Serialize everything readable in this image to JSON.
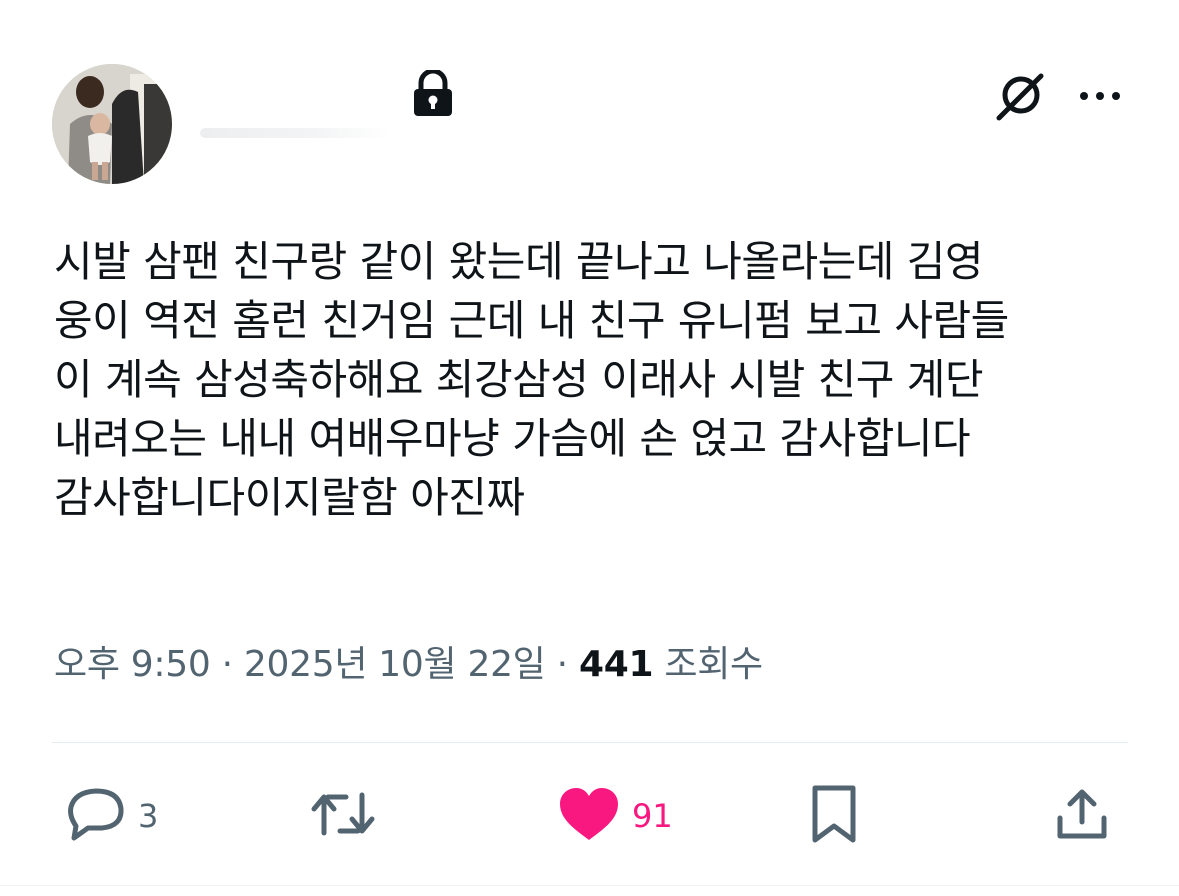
{
  "tweet": {
    "text_lines": [
      "시발 삼팬 친구랑 같이 왔는데 끝나고 나올라는데 김영",
      "웅이 역전 홈런 친거임 근데 내 친구 유니펌 보고 사람들",
      "이 계속 삼성축하해요 최강삼성 이래사 시발 친구 계단",
      "내려오는 내내 여배우마냥 가슴에 손 얹고 감사합니다",
      "감사합니다이지랄함 아진짜"
    ],
    "time": "오후 9:50",
    "separator": "·",
    "date": "2025년 10월 22일",
    "views_count": "441",
    "views_label": "조회수"
  },
  "actions": {
    "reply_count": "3",
    "like_count": "91"
  },
  "icons": {
    "lock": "lock-icon",
    "grok": "grok-icon",
    "more": "more-icon",
    "reply": "reply-icon",
    "retweet": "retweet-icon",
    "like": "heart-icon",
    "bookmark": "bookmark-icon",
    "share": "share-icon"
  },
  "colors": {
    "text": "#0f1419",
    "secondary": "#536471",
    "like": "#f91880"
  }
}
